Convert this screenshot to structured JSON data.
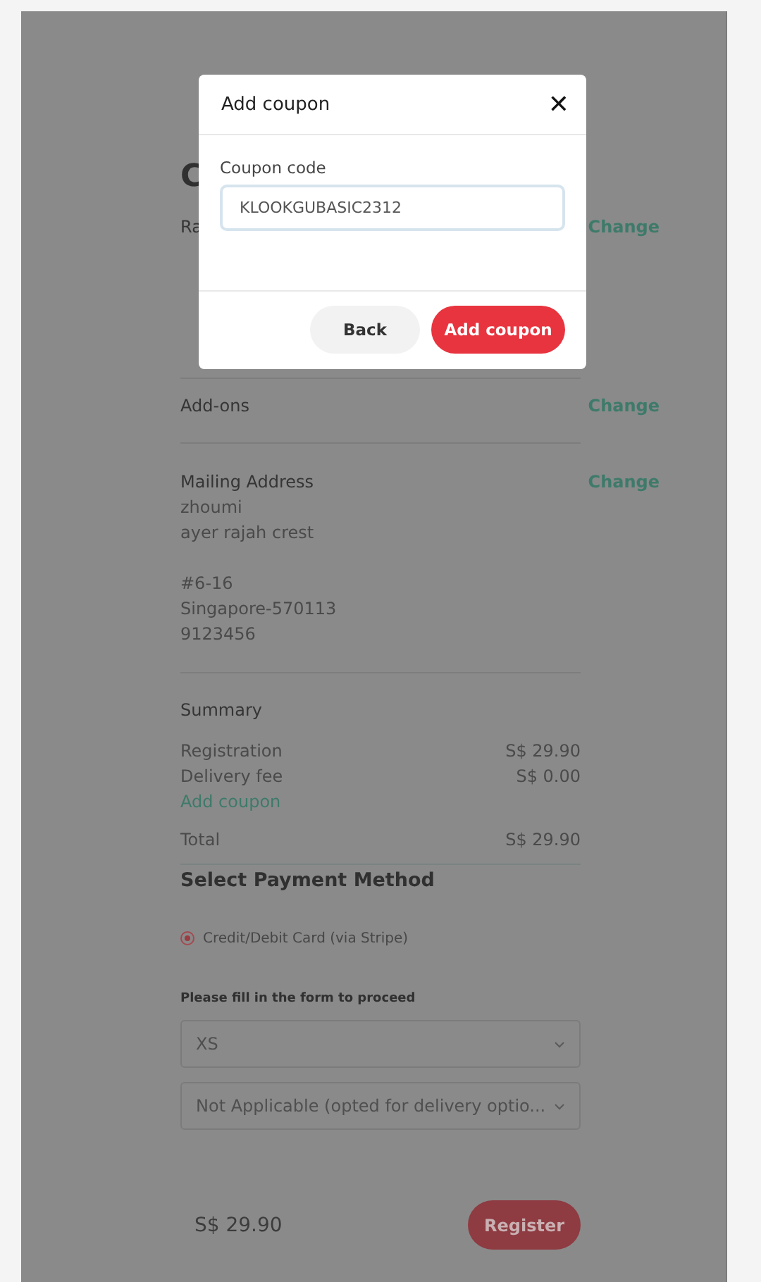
{
  "page": {
    "heading": "C",
    "rate_label": "Ra",
    "rate_change": "Change"
  },
  "addons": {
    "label": "Add-ons",
    "change": "Change"
  },
  "mailing": {
    "label": "Mailing Address",
    "change": "Change",
    "blocks": [
      [
        "zhoumi",
        "ayer rajah crest"
      ],
      [
        "#6-16",
        "Singapore-570113",
        "9123456"
      ]
    ]
  },
  "summary": {
    "title": "Summary",
    "rows": [
      {
        "label": "Registration",
        "value": "S$ 29.90"
      },
      {
        "label": "Delivery fee",
        "value": "S$ 0.00"
      }
    ],
    "add_coupon": "Add coupon",
    "total_label": "Total",
    "total_value": "S$ 29.90"
  },
  "payment": {
    "title": "Select Payment Method",
    "options": [
      {
        "label": "Credit/Debit Card (via Stripe)",
        "selected": true
      }
    ]
  },
  "form": {
    "note": "Please fill in the form to proceed",
    "selects": [
      {
        "value": "XS"
      },
      {
        "value": "Not Applicable (opted for delivery optio..."
      }
    ]
  },
  "footer": {
    "price": "S$ 29.90",
    "button": "Register"
  },
  "modal": {
    "title": "Add coupon",
    "close": "✕",
    "field_label": "Coupon code",
    "field_value": "KLOOKGUBASIC2312",
    "buttons": [
      {
        "label": "Back",
        "kind": "secondary"
      },
      {
        "label": "Add coupon",
        "kind": "primary"
      }
    ]
  }
}
